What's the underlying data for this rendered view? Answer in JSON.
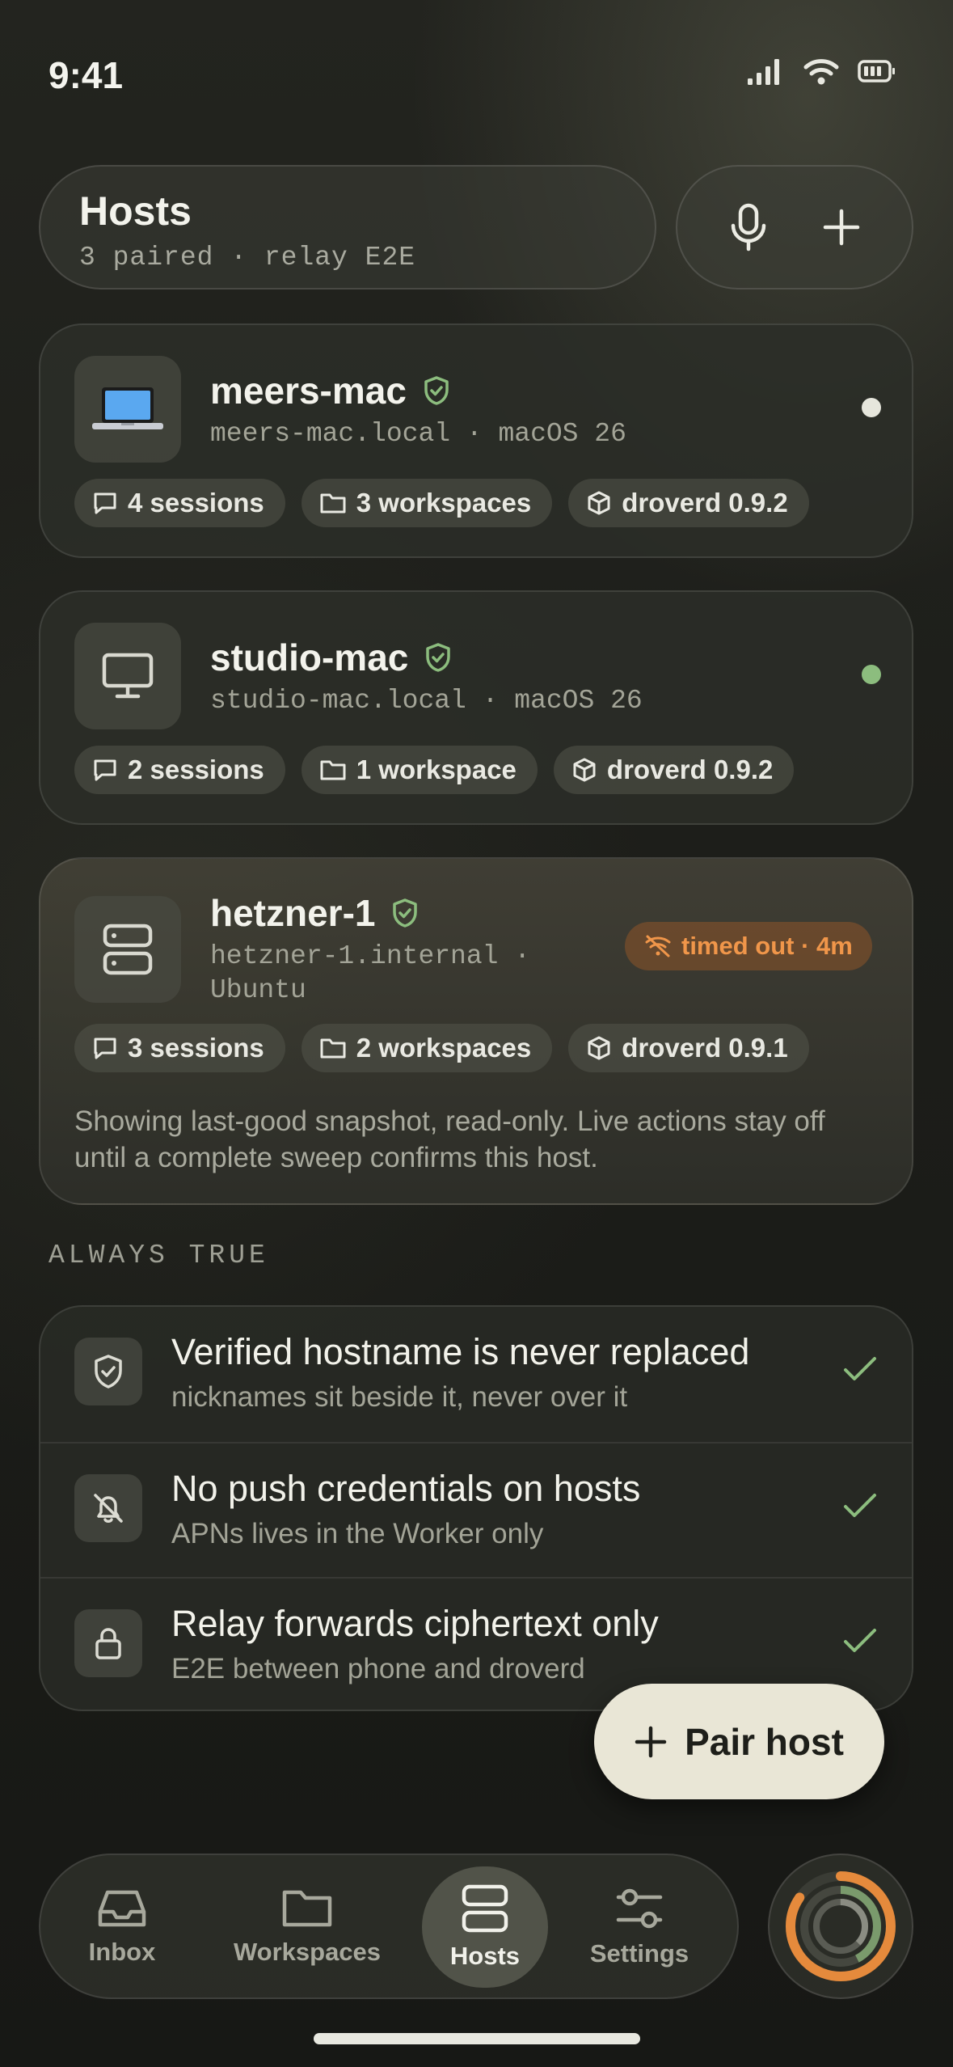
{
  "status_bar": {
    "time": "9:41"
  },
  "header": {
    "title": "Hosts",
    "subtitle": "3 paired · relay E2E"
  },
  "hosts": [
    {
      "name": "meers-mac",
      "address": "meers-mac.local · macOS 26",
      "status_color": "#e6e6dc",
      "chips": [
        "4 sessions",
        "3 workspaces",
        "droverd 0.9.2"
      ]
    },
    {
      "name": "studio-mac",
      "address": "studio-mac.local · macOS 26",
      "status_color": "#8cbd7e",
      "chips": [
        "2 sessions",
        "1 workspace",
        "droverd 0.9.2"
      ]
    },
    {
      "name": "hetzner-1",
      "address_line1": "hetzner-1.internal ·",
      "address_line2": "Ubuntu",
      "badge": "timed out · 4m",
      "chips": [
        "3 sessions",
        "2 workspaces",
        "droverd 0.9.1"
      ],
      "note": "Showing last-good snapshot, read-only. Live actions stay off until a complete sweep confirms this host."
    }
  ],
  "always_true": {
    "label": "ALWAYS TRUE",
    "items": [
      {
        "title": "Verified hostname is never replaced",
        "subtitle": "nicknames sit beside it, never over it",
        "icon": "shield-icon"
      },
      {
        "title": "No push credentials on hosts",
        "subtitle": "APNs lives in the Worker only",
        "icon": "bell-off-icon"
      },
      {
        "title": "Relay forwards ciphertext only",
        "subtitle": "E2E between phone and droverd",
        "icon": "lock-icon"
      }
    ]
  },
  "fab": {
    "label": "Pair host"
  },
  "tabs": [
    {
      "label": "Inbox",
      "icon": "inbox-icon"
    },
    {
      "label": "Workspaces",
      "icon": "folder-icon"
    },
    {
      "label": "Hosts",
      "icon": "server-icon",
      "active": true
    },
    {
      "label": "Settings",
      "icon": "sliders-icon"
    }
  ],
  "colors": {
    "accent_green": "#8cbd7e",
    "warning_orange": "#f0964a",
    "fab_bg": "#e9e6d6"
  }
}
